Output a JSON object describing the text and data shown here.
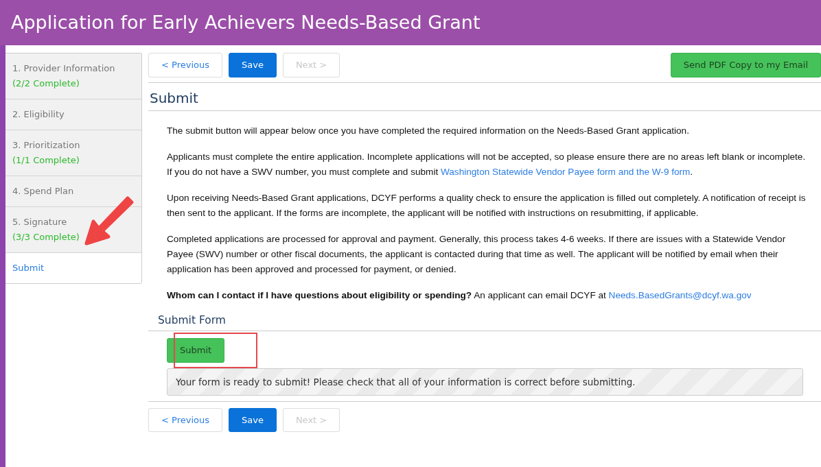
{
  "header": {
    "title": "Application for Early Achievers Needs-Based Grant"
  },
  "sidebar": {
    "items": [
      {
        "label": "1. Provider Information",
        "progress": "(2/2 Complete)",
        "selected": false
      },
      {
        "label": "2. Eligibility",
        "selected": false
      },
      {
        "label": "3. Prioritization",
        "progress": "(1/1 Complete)",
        "selected": false
      },
      {
        "label": "4. Spend Plan",
        "selected": false
      },
      {
        "label": "5. Signature",
        "progress": "(3/3 Complete)",
        "selected": false
      },
      {
        "label": "Submit",
        "selected": true
      }
    ]
  },
  "toolbar_top": {
    "buttons": [
      {
        "label": "< Previous",
        "kind": "outline",
        "disabled": false
      },
      {
        "label": "Save",
        "kind": "primary",
        "disabled": false
      },
      {
        "label": "Next >",
        "kind": "outline",
        "disabled": true
      }
    ],
    "email_button": "Send PDF Copy to my Email"
  },
  "section": {
    "title": "Submit",
    "paragraphs": [
      [
        {
          "kind": "text",
          "text": "The submit button will appear below once you have completed the required information on the Needs-Based Grant application."
        }
      ],
      [
        {
          "kind": "text",
          "text": "Applicants must complete the entire application. Incomplete applications will not be accepted, so please ensure there are no areas left blank or incomplete. If you do not have a SWV number, you must complete and submit "
        },
        {
          "kind": "link",
          "text": "Washington Statewide Vendor Payee form and the W-9 form"
        },
        {
          "kind": "text",
          "text": "."
        }
      ],
      [
        {
          "kind": "text",
          "text": "Upon receiving Needs-Based Grant applications, DCYF performs a quality check to ensure the application is filled out completely. A notification of receipt is then sent to the applicant. If the forms are incomplete, the applicant will be notified with instructions on resubmitting, if applicable."
        }
      ],
      [
        {
          "kind": "text",
          "text": "Completed applications are processed for approval and payment. Generally, this process takes 4-6 weeks. If there are issues with a Statewide Vendor Payee (SWV) number or other fiscal documents, the applicant is contacted during that time as well.  The applicant will be notified by email when their application has been approved and processed for payment, or denied."
        }
      ],
      [
        {
          "kind": "text",
          "text": "**Whom can I contact if I have questions about eligibility or spending?** An applicant can email DCYF at "
        },
        {
          "kind": "link",
          "text": "Needs.BasedGrants@dcyf.wa.gov"
        }
      ]
    ]
  },
  "submit_form": {
    "title": "Submit Form",
    "button": "Submit",
    "message": "Your form is ready to submit! Please check that all of your information is correct before submitting."
  },
  "toolbar_bottom": {
    "buttons": [
      {
        "label": "< Previous",
        "kind": "outline",
        "disabled": false
      },
      {
        "label": "Save",
        "kind": "primary",
        "disabled": false
      },
      {
        "label": "Next >",
        "kind": "outline",
        "disabled": true
      }
    ]
  }
}
